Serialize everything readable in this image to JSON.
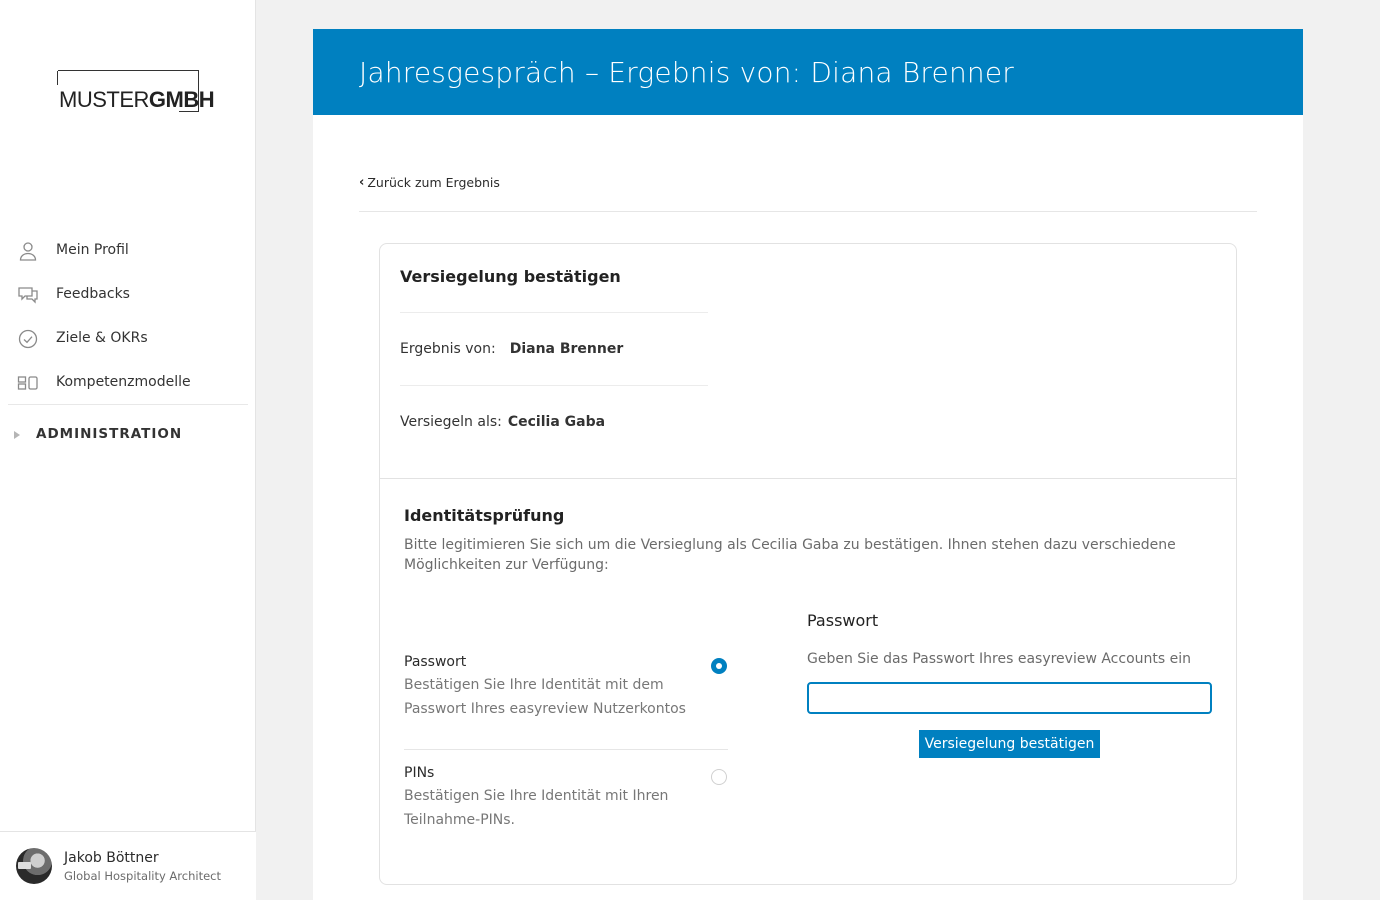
{
  "brand": {
    "logo_light": "MUSTER",
    "logo_bold": "GMBH"
  },
  "nav": {
    "items": [
      {
        "label": "Mein Profil",
        "icon": "user-icon"
      },
      {
        "label": "Feedbacks",
        "icon": "chat-icon"
      },
      {
        "label": "Ziele & OKRs",
        "icon": "check-circle-icon"
      },
      {
        "label": "Kompetenzmodelle",
        "icon": "model-icon"
      }
    ],
    "admin_label": "ADMINISTRATION"
  },
  "user": {
    "name": "Jakob Böttner",
    "role": "Global Hospitality Architect"
  },
  "header": {
    "title": "Jahresgespräch – Ergebnis von: Diana Brenner"
  },
  "back_link": "Zurück zum Ergebnis",
  "seal": {
    "title": "Versiegelung bestätigen",
    "result_label": "Ergebnis von:",
    "result_value": "Diana Brenner",
    "seal_as_label": "Versiegeln als:",
    "seal_as_value": "Cecilia Gaba"
  },
  "identity": {
    "title": "Identitätsprüfung",
    "description": "Bitte legitimieren Sie sich um die Versieglung als Cecilia Gaba zu bestätigen. Ihnen stehen dazu verschiedene Möglichkeiten zur Verfügung:",
    "options": [
      {
        "title": "Passwort",
        "description": "Bestätigen Sie Ihre Identität mit dem Passwort Ihres easyreview Nutzerkontos",
        "selected": true
      },
      {
        "title": "PINs",
        "description": "Bestätigen Sie Ihre Identität mit Ihren Teilnahme-PINs.",
        "selected": false
      }
    ]
  },
  "password_form": {
    "title": "Passwort",
    "description": "Geben Sie das Passwort Ihres easyreview Accounts ein",
    "value": "",
    "placeholder": "",
    "button": "Versiegelung bestätigen"
  },
  "colors": {
    "accent": "#0080c0"
  }
}
